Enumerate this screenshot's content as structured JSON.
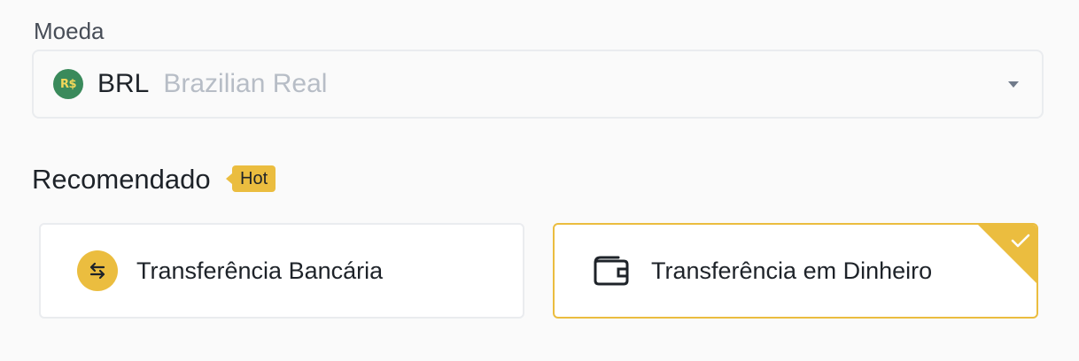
{
  "currency_field": {
    "label": "Moeda",
    "coin_symbol": "R$",
    "code": "BRL",
    "name": "Brazilian Real",
    "dropdown_icon": "caret-down-icon"
  },
  "recommended": {
    "title": "Recomendado",
    "badge": "Hot"
  },
  "payment_methods": [
    {
      "label": "Transferência Bancária",
      "icon": "swap-arrows-icon",
      "selected": false
    },
    {
      "label": "Transferência em Dinheiro",
      "icon": "wallet-icon",
      "selected": true
    }
  ],
  "colors": {
    "accent": "#ebbd3f",
    "coin_bg": "#3a8a5b",
    "border": "#eaecef",
    "text_primary": "#1e2329",
    "text_secondary": "#b7bdc6"
  }
}
